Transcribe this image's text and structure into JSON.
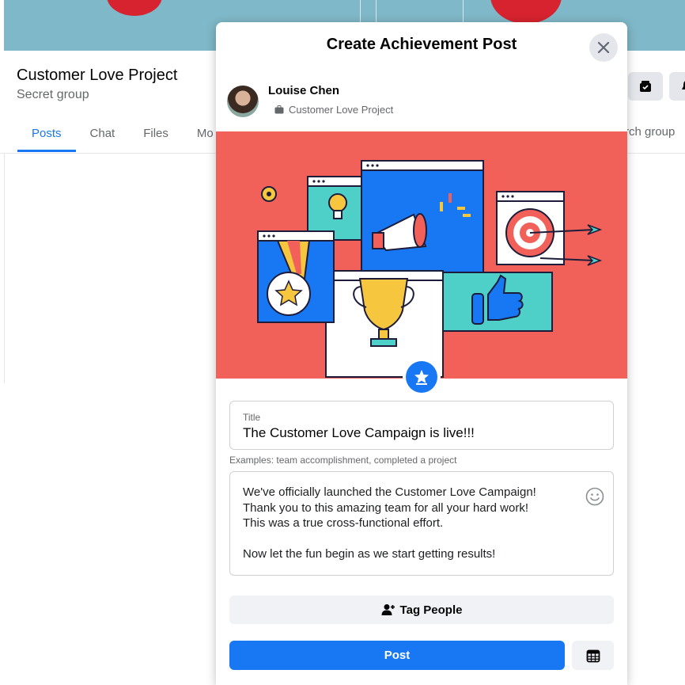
{
  "group": {
    "name": "Customer Love Project",
    "privacy": "Secret group",
    "tabs": [
      {
        "label": "Posts",
        "active": true
      },
      {
        "label": "Chat",
        "active": false
      },
      {
        "label": "Files",
        "active": false
      },
      {
        "label": "Mo",
        "active": false
      }
    ],
    "search_partial": "rch group",
    "header_icons": [
      "marketplace-icon",
      "bell-icon"
    ]
  },
  "modal": {
    "title": "Create Achievement Post",
    "close_icon": "close-icon",
    "author": {
      "name": "Louise Chen",
      "group": "Customer Love Project",
      "group_icon": "briefcase-icon"
    },
    "badge_icon": "achievement-star-icon",
    "title_field": {
      "label": "Title",
      "value": "The Customer Love Campaign is live!!!"
    },
    "hint": "Examples: team accomplishment, completed a project",
    "body_text": "We've officially launched the Customer Love Campaign!\nThank you to this amazing team for all your hard work!\nThis was a true cross-functional effort.\n\nNow let the fun begin as we start getting results!",
    "emoji_icon": "smiley-icon",
    "tag_people": "Tag People",
    "tag_icon": "person-plus-icon",
    "post_label": "Post",
    "schedule_icon": "calendar-icon"
  },
  "colors": {
    "accent": "#1877f2",
    "banner": "#f1615a",
    "cover": "#7fb8c8"
  }
}
